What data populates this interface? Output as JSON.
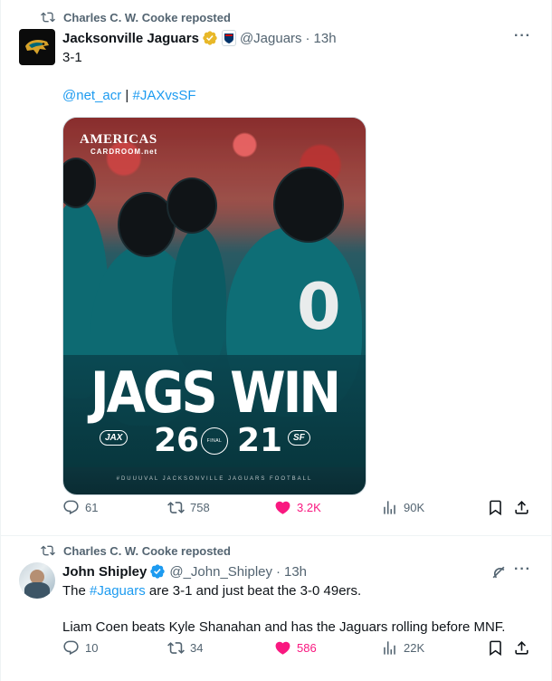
{
  "tweets": [
    {
      "repost_label": "Charles C. W. Cooke reposted",
      "author_name": "Jacksonville Jaguars",
      "author_handle": "@Jaguars",
      "time": "13h",
      "body": "3-1",
      "mention": "@net_acr",
      "separator": " | ",
      "hashtag": "#JAXvsSF",
      "media": {
        "brand": "AMERICAS",
        "brand_sub": "CARDROOM.net",
        "headline": "JAGS WIN",
        "score_home": "26",
        "score_away": "21",
        "final_label": "FINAL",
        "home_logo_text": "JAX",
        "away_logo_text": "SF",
        "footer": "#DUUUVAL  JACKSONVILLE JAGUARS FOOTBALL"
      },
      "replies": "61",
      "reposts": "758",
      "likes": "3.2K",
      "views": "90K"
    },
    {
      "repost_label": "Charles C. W. Cooke reposted",
      "author_name": "John Shipley",
      "author_handle": "@_John_Shipley",
      "time": "13h",
      "body_prefix": "The ",
      "body_hashtag": "#Jaguars",
      "body_suffix": " are 3-1 and just beat the 3-0 49ers.",
      "body_2": "Liam Coen beats Kyle Shanahan and has the Jaguars rolling before MNF.",
      "replies": "10",
      "reposts": "34",
      "likes": "586",
      "views": "22K"
    }
  ],
  "colors": {
    "accent": "#1d9bf0",
    "like": "#f91880",
    "muted": "#536471",
    "verified_gold": "#e8b829",
    "verified_blue": "#1d9bf0"
  },
  "icons": [
    "repost-icon",
    "verified-icon",
    "more-icon",
    "reply-icon",
    "like-icon",
    "views-icon",
    "bookmark-icon",
    "share-icon",
    "grok-icon"
  ]
}
